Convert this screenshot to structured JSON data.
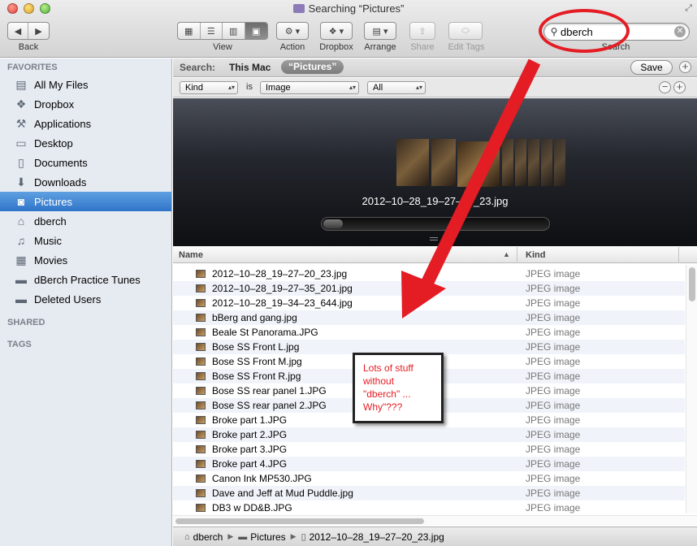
{
  "window": {
    "title": "Searching “Pictures”"
  },
  "toolbar": {
    "back_label": "Back",
    "view_label": "View",
    "action_label": "Action",
    "dropbox_label": "Dropbox",
    "arrange_label": "Arrange",
    "share_label": "Share",
    "edit_tags_label": "Edit Tags",
    "search_label": "Search",
    "search_value": "dberch"
  },
  "sidebar": {
    "favorites_header": "FAVORITES",
    "items": [
      {
        "label": "All My Files",
        "icon": "all-files-icon"
      },
      {
        "label": "Dropbox",
        "icon": "dropbox-icon"
      },
      {
        "label": "Applications",
        "icon": "applications-icon"
      },
      {
        "label": "Desktop",
        "icon": "desktop-icon"
      },
      {
        "label": "Documents",
        "icon": "documents-icon"
      },
      {
        "label": "Downloads",
        "icon": "downloads-icon"
      },
      {
        "label": "Pictures",
        "icon": "camera-icon",
        "selected": true
      },
      {
        "label": "dberch",
        "icon": "home-icon"
      },
      {
        "label": "Music",
        "icon": "music-icon"
      },
      {
        "label": "Movies",
        "icon": "movies-icon"
      },
      {
        "label": "dBerch Practice Tunes",
        "icon": "folder-icon"
      },
      {
        "label": "Deleted Users",
        "icon": "folder-icon"
      }
    ],
    "shared_header": "SHARED",
    "tags_header": "TAGS"
  },
  "scope": {
    "label": "Search:",
    "this_mac": "This Mac",
    "pictures": "“Pictures”",
    "save_label": "Save"
  },
  "criteria": {
    "attribute": "Kind",
    "operator": "is",
    "value": "Image",
    "subvalue": "All"
  },
  "coverflow": {
    "filename": "2012–10–28_19–27–20_23.jpg"
  },
  "list": {
    "col_name": "Name",
    "col_kind": "Kind",
    "rows": [
      {
        "name": "2012–10–28_19–27–20_23.jpg",
        "kind": "JPEG image"
      },
      {
        "name": "2012–10–28_19–27–35_201.jpg",
        "kind": "JPEG image"
      },
      {
        "name": "2012–10–28_19–34–23_644.jpg",
        "kind": "JPEG image"
      },
      {
        "name": "bBerg and gang.jpg",
        "kind": "JPEG image"
      },
      {
        "name": "Beale St Panorama.JPG",
        "kind": "JPEG image"
      },
      {
        "name": "Bose SS Front L.jpg",
        "kind": "JPEG image"
      },
      {
        "name": "Bose SS Front M.jpg",
        "kind": "JPEG image"
      },
      {
        "name": "Bose SS Front R.jpg",
        "kind": "JPEG image"
      },
      {
        "name": "Bose SS rear panel 1.JPG",
        "kind": "JPEG image"
      },
      {
        "name": "Bose SS rear panel 2.JPG",
        "kind": "JPEG image"
      },
      {
        "name": "Broke part 1.JPG",
        "kind": "JPEG image"
      },
      {
        "name": "Broke part 2.JPG",
        "kind": "JPEG image"
      },
      {
        "name": "Broke part 3.JPG",
        "kind": "JPEG image"
      },
      {
        "name": "Broke part 4.JPG",
        "kind": "JPEG image"
      },
      {
        "name": "Canon Ink MP530.JPG",
        "kind": "JPEG image"
      },
      {
        "name": "Dave and Jeff at Mud Puddle.jpg",
        "kind": "JPEG image"
      },
      {
        "name": "DB3 w DD&B.JPG",
        "kind": "JPEG image"
      }
    ]
  },
  "pathbar": {
    "user": "dberch",
    "folder": "Pictures",
    "file": "2012–10–28_19–27–20_23.jpg"
  },
  "annotation": {
    "callout_line1": "Lots of stuff",
    "callout_line2": "without",
    "callout_line3": "\"dberch\" ...",
    "callout_line4": "Why\"???",
    "color": "#e41c24"
  }
}
